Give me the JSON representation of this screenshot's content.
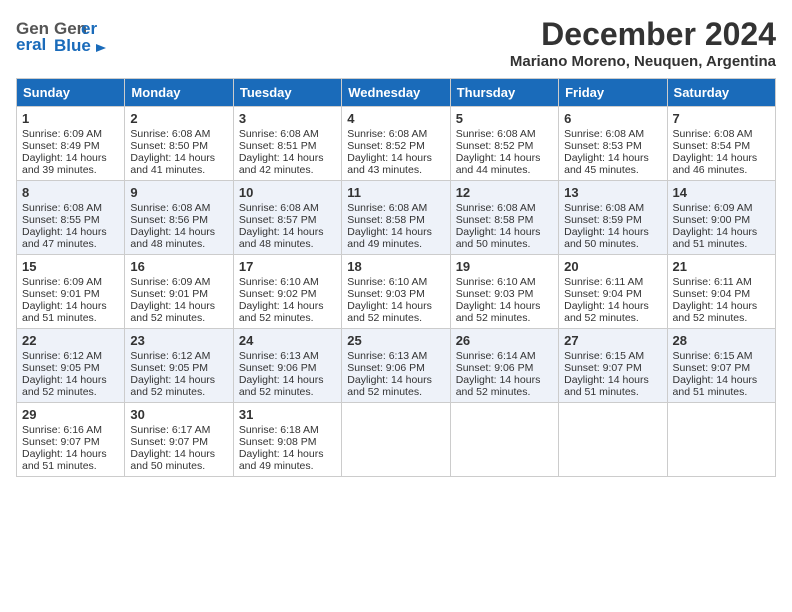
{
  "header": {
    "logo_general": "General",
    "logo_blue": "Blue",
    "title": "December 2024",
    "subtitle": "Mariano Moreno, Neuquen, Argentina"
  },
  "calendar": {
    "days_of_week": [
      "Sunday",
      "Monday",
      "Tuesday",
      "Wednesday",
      "Thursday",
      "Friday",
      "Saturday"
    ],
    "weeks": [
      [
        null,
        {
          "day": "2",
          "sunrise": "Sunrise: 6:08 AM",
          "sunset": "Sunset: 8:50 PM",
          "daylight": "Daylight: 14 hours and 41 minutes."
        },
        {
          "day": "3",
          "sunrise": "Sunrise: 6:08 AM",
          "sunset": "Sunset: 8:51 PM",
          "daylight": "Daylight: 14 hours and 42 minutes."
        },
        {
          "day": "4",
          "sunrise": "Sunrise: 6:08 AM",
          "sunset": "Sunset: 8:52 PM",
          "daylight": "Daylight: 14 hours and 43 minutes."
        },
        {
          "day": "5",
          "sunrise": "Sunrise: 6:08 AM",
          "sunset": "Sunset: 8:52 PM",
          "daylight": "Daylight: 14 hours and 44 minutes."
        },
        {
          "day": "6",
          "sunrise": "Sunrise: 6:08 AM",
          "sunset": "Sunset: 8:53 PM",
          "daylight": "Daylight: 14 hours and 45 minutes."
        },
        {
          "day": "7",
          "sunrise": "Sunrise: 6:08 AM",
          "sunset": "Sunset: 8:54 PM",
          "daylight": "Daylight: 14 hours and 46 minutes."
        }
      ],
      [
        {
          "day": "1",
          "sunrise": "Sunrise: 6:09 AM",
          "sunset": "Sunset: 8:49 PM",
          "daylight": "Daylight: 14 hours and 39 minutes."
        },
        {
          "day": "9",
          "sunrise": "Sunrise: 6:08 AM",
          "sunset": "Sunset: 8:56 PM",
          "daylight": "Daylight: 14 hours and 48 minutes."
        },
        {
          "day": "10",
          "sunrise": "Sunrise: 6:08 AM",
          "sunset": "Sunset: 8:57 PM",
          "daylight": "Daylight: 14 hours and 48 minutes."
        },
        {
          "day": "11",
          "sunrise": "Sunrise: 6:08 AM",
          "sunset": "Sunset: 8:58 PM",
          "daylight": "Daylight: 14 hours and 49 minutes."
        },
        {
          "day": "12",
          "sunrise": "Sunrise: 6:08 AM",
          "sunset": "Sunset: 8:58 PM",
          "daylight": "Daylight: 14 hours and 50 minutes."
        },
        {
          "day": "13",
          "sunrise": "Sunrise: 6:08 AM",
          "sunset": "Sunset: 8:59 PM",
          "daylight": "Daylight: 14 hours and 50 minutes."
        },
        {
          "day": "14",
          "sunrise": "Sunrise: 6:09 AM",
          "sunset": "Sunset: 9:00 PM",
          "daylight": "Daylight: 14 hours and 51 minutes."
        }
      ],
      [
        {
          "day": "8",
          "sunrise": "Sunrise: 6:08 AM",
          "sunset": "Sunset: 8:55 PM",
          "daylight": "Daylight: 14 hours and 47 minutes."
        },
        {
          "day": "16",
          "sunrise": "Sunrise: 6:09 AM",
          "sunset": "Sunset: 9:01 PM",
          "daylight": "Daylight: 14 hours and 52 minutes."
        },
        {
          "day": "17",
          "sunrise": "Sunrise: 6:10 AM",
          "sunset": "Sunset: 9:02 PM",
          "daylight": "Daylight: 14 hours and 52 minutes."
        },
        {
          "day": "18",
          "sunrise": "Sunrise: 6:10 AM",
          "sunset": "Sunset: 9:03 PM",
          "daylight": "Daylight: 14 hours and 52 minutes."
        },
        {
          "day": "19",
          "sunrise": "Sunrise: 6:10 AM",
          "sunset": "Sunset: 9:03 PM",
          "daylight": "Daylight: 14 hours and 52 minutes."
        },
        {
          "day": "20",
          "sunrise": "Sunrise: 6:11 AM",
          "sunset": "Sunset: 9:04 PM",
          "daylight": "Daylight: 14 hours and 52 minutes."
        },
        {
          "day": "21",
          "sunrise": "Sunrise: 6:11 AM",
          "sunset": "Sunset: 9:04 PM",
          "daylight": "Daylight: 14 hours and 52 minutes."
        }
      ],
      [
        {
          "day": "15",
          "sunrise": "Sunrise: 6:09 AM",
          "sunset": "Sunset: 9:01 PM",
          "daylight": "Daylight: 14 hours and 51 minutes."
        },
        {
          "day": "23",
          "sunrise": "Sunrise: 6:12 AM",
          "sunset": "Sunset: 9:05 PM",
          "daylight": "Daylight: 14 hours and 52 minutes."
        },
        {
          "day": "24",
          "sunrise": "Sunrise: 6:13 AM",
          "sunset": "Sunset: 9:06 PM",
          "daylight": "Daylight: 14 hours and 52 minutes."
        },
        {
          "day": "25",
          "sunrise": "Sunrise: 6:13 AM",
          "sunset": "Sunset: 9:06 PM",
          "daylight": "Daylight: 14 hours and 52 minutes."
        },
        {
          "day": "26",
          "sunrise": "Sunrise: 6:14 AM",
          "sunset": "Sunset: 9:06 PM",
          "daylight": "Daylight: 14 hours and 52 minutes."
        },
        {
          "day": "27",
          "sunrise": "Sunrise: 6:15 AM",
          "sunset": "Sunset: 9:07 PM",
          "daylight": "Daylight: 14 hours and 51 minutes."
        },
        {
          "day": "28",
          "sunrise": "Sunrise: 6:15 AM",
          "sunset": "Sunset: 9:07 PM",
          "daylight": "Daylight: 14 hours and 51 minutes."
        }
      ],
      [
        {
          "day": "22",
          "sunrise": "Sunrise: 6:12 AM",
          "sunset": "Sunset: 9:05 PM",
          "daylight": "Daylight: 14 hours and 52 minutes."
        },
        {
          "day": "30",
          "sunrise": "Sunrise: 6:17 AM",
          "sunset": "Sunset: 9:07 PM",
          "daylight": "Daylight: 14 hours and 50 minutes."
        },
        {
          "day": "31",
          "sunrise": "Sunrise: 6:18 AM",
          "sunset": "Sunset: 9:08 PM",
          "daylight": "Daylight: 14 hours and 49 minutes."
        },
        null,
        null,
        null,
        null
      ]
    ],
    "week1_day1_override": {
      "day": "29",
      "sunrise": "Sunrise: 6:16 AM",
      "sunset": "Sunset: 9:07 PM",
      "daylight": "Daylight: 14 hours and 51 minutes."
    }
  }
}
